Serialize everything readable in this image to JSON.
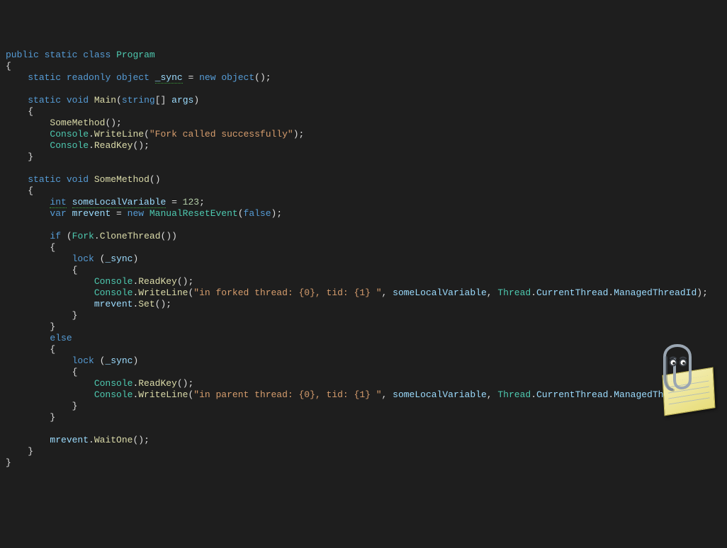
{
  "tokens": {
    "public": "public",
    "static": "static",
    "class": "class",
    "Program": "Program",
    "readonly": "readonly",
    "object": "object",
    "sync": "_sync",
    "new": "new",
    "void": "void",
    "Main": "Main",
    "string": "string",
    "args": "args",
    "SomeMethod": "SomeMethod",
    "Console": "Console",
    "WriteLine": "WriteLine",
    "ReadKey": "ReadKey",
    "fork_ok": "\"Fork called successfully\"",
    "int": "int",
    "someLocalVariable": "someLocalVariable",
    "n123": "123",
    "var": "var",
    "mrevent": "mrevent",
    "ManualResetEvent": "ManualResetEvent",
    "false": "false",
    "if": "if",
    "Fork": "Fork",
    "CloneThread": "CloneThread",
    "lock": "lock",
    "in_forked": "\"in forked thread: {0}, tid: {1} \"",
    "in_parent": "\"in parent thread: {0}, tid: {1} \"",
    "Thread": "Thread",
    "CurrentThread": "CurrentThread",
    "ManagedThreadId": "ManagedThreadId",
    "Set": "Set",
    "else": "else",
    "WaitOne": "WaitOne",
    "ob": "{",
    "cb": "}",
    "op": "(",
    "cp": ")",
    "obp": "()",
    "sc": ";",
    "cm": ", ",
    "dot": ".",
    "eq": " = ",
    "sqb": "[]"
  },
  "assistant": {
    "name": "clippy-assistant"
  }
}
